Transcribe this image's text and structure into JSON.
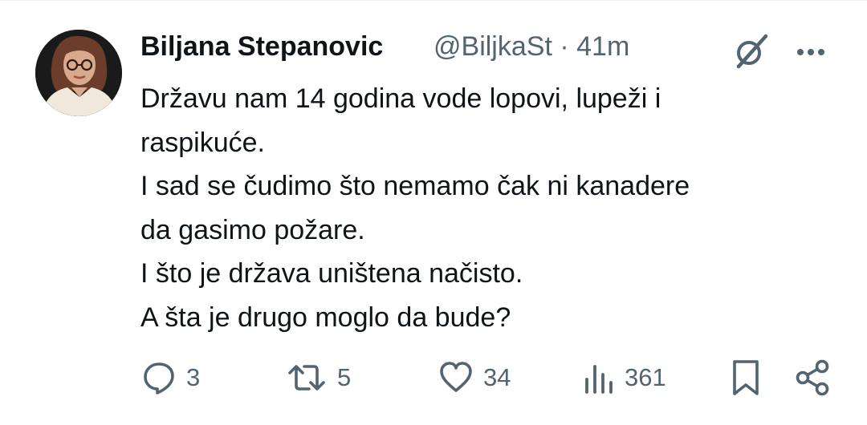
{
  "author": {
    "name": "Biljana Stepanovic",
    "handle": "@BiljkaSt",
    "separator": "·",
    "time": "41m"
  },
  "tweet": {
    "lines": [
      "Državu nam 14 godina vode lopovi, lupeži i",
      "raspikuće.",
      "I sad se čudimo što nemamo čak ni kanadere",
      "da gasimo požare.",
      "I što je država uništena načisto.",
      "A šta je drugo moglo da bude?"
    ]
  },
  "actions": {
    "replies": "3",
    "reposts": "5",
    "likes": "34",
    "views": "361"
  },
  "icons": {
    "grok": "grok-icon",
    "more": "more-icon",
    "reply": "reply-icon",
    "repost": "repost-icon",
    "like": "like-icon",
    "views": "views-icon",
    "bookmark": "bookmark-icon",
    "share": "share-icon"
  },
  "colors": {
    "text": "#0f1419",
    "secondary": "#536471",
    "background": "#ffffff"
  }
}
